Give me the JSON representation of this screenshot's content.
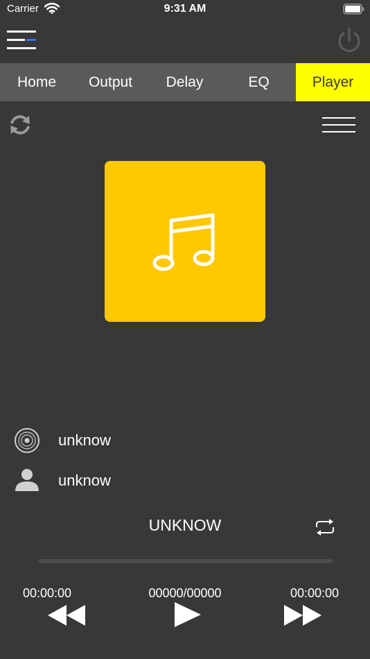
{
  "status_bar": {
    "carrier": "Carrier",
    "time": "9:31 AM"
  },
  "header": {
    "menu_icon": "hamburger-menu-icon",
    "power_icon": "power-icon"
  },
  "tabs": [
    {
      "label": "Home",
      "active": false
    },
    {
      "label": "Output",
      "active": false
    },
    {
      "label": "Delay",
      "active": false
    },
    {
      "label": "EQ",
      "active": false
    },
    {
      "label": "Player",
      "active": true
    }
  ],
  "player": {
    "album": "unknow",
    "artist": "unknow",
    "title": "UNKNOW",
    "elapsed": "00:00:00",
    "track_counter": "00000/00000",
    "duration": "00:00:00",
    "progress": 0
  },
  "colors": {
    "background": "#383838",
    "tab_bar": "#5a5a5a",
    "active_tab": "#ffff00",
    "artwork": "#ffc800"
  }
}
